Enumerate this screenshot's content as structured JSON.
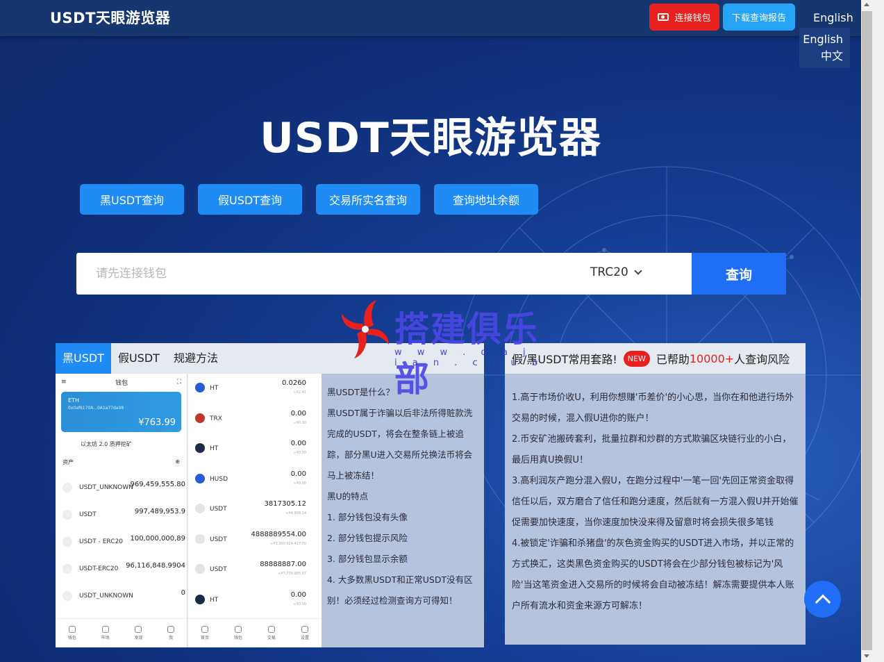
{
  "header": {
    "logo": "USDT天眼游览器",
    "connect_wallet": "连接钱包",
    "download_report": "下载查询报告",
    "language_current": "English",
    "language_options": [
      "English",
      "中文"
    ]
  },
  "hero": {
    "title": "USDT天眼游览器",
    "quick_buttons": [
      "黑USDT查询",
      "假USDT查询",
      "交易所实名查询",
      "查询地址余额"
    ]
  },
  "search": {
    "placeholder": "请先连接钱包",
    "network": "TRC20",
    "button": "查询"
  },
  "watermark": {
    "text": "搭建俱乐部",
    "url": "w w w . d a j i a n . c l u b"
  },
  "left_panel": {
    "tabs": [
      "黑USDT",
      "假USDT",
      "规避方法"
    ],
    "paragraphs": [
      "黑USDT是什么？",
      "黑USDT属于诈骗以后非法所得赃款洗完成的USDT，将会在整条链上被追踪，部分黑U进入交易所兑换法币将会马上被冻结！",
      "黑U的特点",
      "1. 部分钱包没有头像",
      "2. 部分钱包提示风险",
      "3. 部分钱包显示余额",
      "4. 大多数黑USDT和正常USDT没有区别！必须经过检测查询方可得知！"
    ],
    "phone_a": {
      "title": "钱包",
      "card_name": "ETH",
      "card_address": "0x0af6170A...0A1a77da98",
      "card_balance": "¥763.99",
      "stake": "以太坊 2.0 质押挖矿",
      "assets_label": "资产",
      "rows": [
        {
          "name": "USDT_UNKNOWN",
          "amount": "969,459,555.80"
        },
        {
          "name": "USDT",
          "amount": "997,489,953.9"
        },
        {
          "name": "USDT - ERC20",
          "amount": "100,000,000,89"
        },
        {
          "name": "USDT-ERC20",
          "amount": "96,116,848.9904"
        },
        {
          "name": "USDT_UNKNOWN",
          "amount": "0"
        }
      ],
      "nav": [
        "钱包",
        "市场",
        "发现",
        "我"
      ]
    },
    "phone_b": {
      "rows": [
        {
          "name": "HT",
          "value": "0.0260",
          "sub": "≈¥2.41",
          "color": "#2a5bd7"
        },
        {
          "name": "TRX",
          "value": "0.00",
          "sub": "≈¥0.00",
          "color": "#c0392b"
        },
        {
          "name": "HT",
          "value": "0.00",
          "sub": "≈¥0.00",
          "color": "#1b2a4a"
        },
        {
          "name": "HUSD",
          "value": "0.00",
          "sub": "≈¥0.00",
          "color": "#2a5bd7"
        },
        {
          "name": "USDT",
          "value": "3817305.12",
          "sub": "≈¥4,908.14",
          "color": "#e3e3e3"
        },
        {
          "name": "USDT",
          "value": "4888889554.00",
          "sub": "≈¥3,300,924,427.70",
          "color": "#e3e3e3"
        },
        {
          "name": "USDT",
          "value": "88888887.00",
          "sub": "≈¥7,770,905.57",
          "color": "#e3e3e3"
        },
        {
          "name": "HT",
          "value": "0.00",
          "sub": "≈¥0.00",
          "color": "#1b2a4a"
        }
      ],
      "nav": [
        "首页",
        "钱包",
        "交易",
        "设置"
      ]
    }
  },
  "right_panel": {
    "title_prefix": "假/黑USDT常用套路!",
    "badge": "NEW",
    "help_prefix": "已帮助",
    "help_count": "10000+",
    "help_suffix": "人查询风险",
    "paragraphs": [
      "1.高于市场价收U，利用你想赚'币差价'的小心思，当你在和他进行场外交易的时候，混入假U进你的账户！",
      "2.币安矿池搬砖套利，批量拉群和炒群的方式欺骗区块链行业的小白，最后用真U换假U！",
      "3.高利润灰产跑分混入假U，在跑分过程中'一笔一回'先回正常资金取得信任以后，双方磨合了信任和跑分速度，然后就有一方混入假U并开始催促需要加快速度，当你速度加快没来得及留意时将会损失很多笔钱",
      "4.被锁定'诈骗和杀猪盘'的灰色资金购买的USDT进入市场，并以正常的方式换汇，这类黑色资金购买的USDT将会在少部分钱包被标记为'风险'当这笔资金进入交易所的时候将会自动被冻结！解冻需要提供本人账户所有流水和资金来源方可解冻！"
    ]
  },
  "colors": {
    "accent_blue": "#1f8bf5",
    "search_blue": "#1f6ef5",
    "danger_red": "#e8201e",
    "header_bg": "#16366f"
  }
}
